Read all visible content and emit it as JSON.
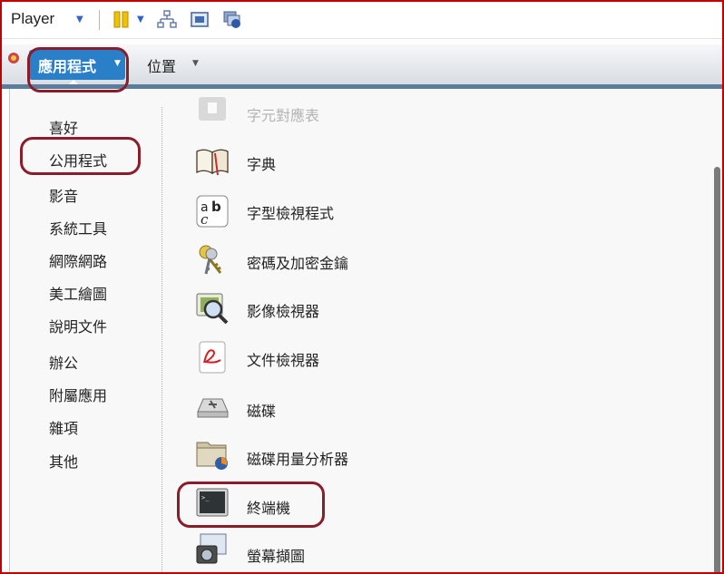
{
  "toolbar": {
    "player_label": "Player",
    "icons": [
      "dropdown-arrow-icon",
      "pause-icon",
      "network-icon",
      "fullscreen-icon",
      "unity-icon"
    ]
  },
  "panel": {
    "applications_label": "應用程式",
    "places_label": "位置"
  },
  "categories": [
    "喜好",
    "公用程式",
    "影音",
    "系統工具",
    "網際網路",
    "美工繪圖",
    "說明文件",
    "辦公",
    "附屬應用",
    "雜項",
    "其他"
  ],
  "apps": [
    {
      "label": "字元對應表",
      "icon": "character-map-icon"
    },
    {
      "label": "字典",
      "icon": "dictionary-icon"
    },
    {
      "label": "字型檢視程式",
      "icon": "font-viewer-icon"
    },
    {
      "label": "密碼及加密金鑰",
      "icon": "keys-icon"
    },
    {
      "label": "影像檢視器",
      "icon": "image-viewer-icon"
    },
    {
      "label": "文件檢視器",
      "icon": "document-viewer-icon"
    },
    {
      "label": "磁碟",
      "icon": "disks-icon"
    },
    {
      "label": "磁碟用量分析器",
      "icon": "disk-usage-icon"
    },
    {
      "label": "終端機",
      "icon": "terminal-icon"
    },
    {
      "label": "螢幕擷圖",
      "icon": "screenshot-icon"
    }
  ],
  "colors": {
    "frame_border": "#c00000",
    "highlight_outline": "#8a1d2a",
    "active_menu": "#2a7fc9"
  }
}
